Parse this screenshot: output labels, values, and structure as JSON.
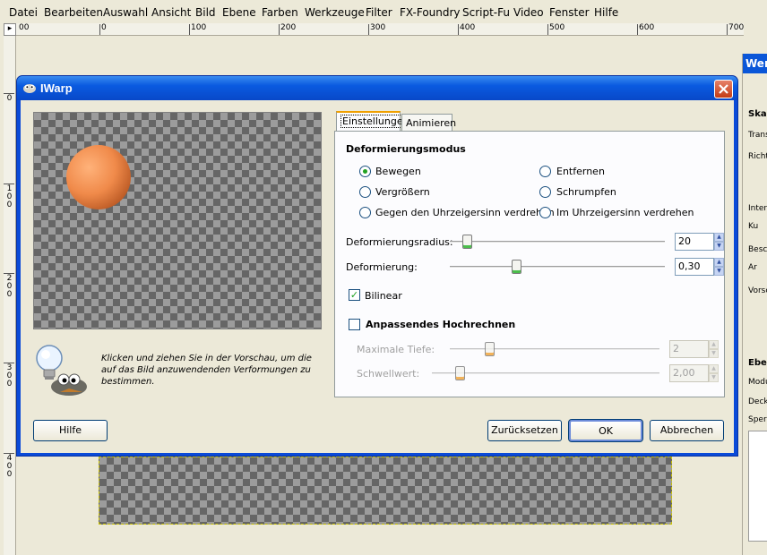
{
  "menubar": {
    "items": [
      "Datei",
      "Bearbeiten",
      "Auswahl",
      "Ansicht",
      "Bild",
      "Ebene",
      "Farben",
      "Werkzeuge",
      "Filter",
      "FX-Foundry",
      "Script-Fu",
      "Video",
      "Fenster",
      "Hilfe"
    ]
  },
  "ruler": {
    "h_labels": [
      "00",
      "0",
      "100",
      "200",
      "300",
      "400",
      "500",
      "600",
      "700"
    ],
    "v_labels": [
      "0",
      "1\n0\n0",
      "2\n0\n0",
      "3\n0\n0",
      "4\n0\n0"
    ]
  },
  "dock": {
    "title": "Werk",
    "labels": [
      "Skali",
      "Trans",
      "Richtu",
      "Interp",
      "Ku",
      "Besch",
      "Ar",
      "Vorsc",
      "Ebe",
      "Modu",
      "Deck",
      "Sperr"
    ]
  },
  "dialog": {
    "title": "IWarp",
    "hint": "Klicken und ziehen Sie in der Vorschau, um die auf das Bild anzuwendenden Verformungen zu bestimmen.",
    "tabs": [
      "Einstellungen",
      "Animieren"
    ],
    "mode_section": "Deformierungsmodus",
    "modes": [
      {
        "label": "Bewegen",
        "selected": true
      },
      {
        "label": "Entfernen",
        "selected": false
      },
      {
        "label": "Vergrößern",
        "selected": false
      },
      {
        "label": "Schrumpfen",
        "selected": false
      },
      {
        "label": "Gegen den Uhrzeigersinn verdrehen",
        "selected": false
      },
      {
        "label": "Im Uhrzeigersinn verdrehen",
        "selected": false
      }
    ],
    "radius_label": "Deformierungsradius:",
    "radius_value": "20",
    "amount_label": "Deformierung:",
    "amount_value": "0,30",
    "bilinear_label": "Bilinear",
    "bilinear_checked": true,
    "supersample_label": "Anpassendes Hochrechnen",
    "supersample_checked": false,
    "max_depth_label": "Maximale Tiefe:",
    "max_depth_value": "2",
    "threshold_label": "Schwellwert:",
    "threshold_value": "2,00",
    "buttons": {
      "help": "Hilfe",
      "reset": "Zurücksetzen",
      "ok": "OK",
      "cancel": "Abbrechen"
    }
  },
  "colors": {
    "titlebar": "#0a5ae0",
    "selected_radio": "#21a121",
    "sphere": "#f08a4a"
  }
}
